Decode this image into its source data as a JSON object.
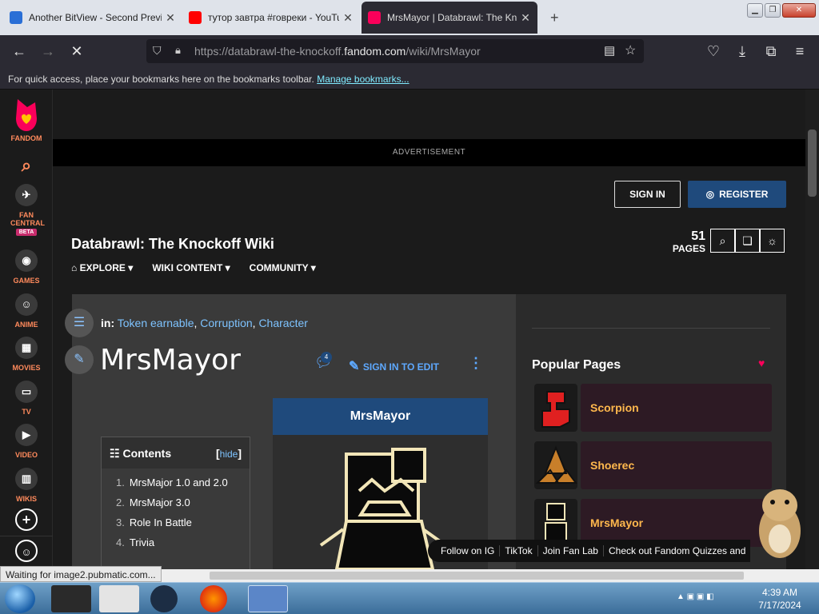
{
  "browser": {
    "tabs": [
      {
        "title": "Another BitView - Second Previ",
        "favicon_color": "#2a6fd6"
      },
      {
        "title": "тутор завтра #говреки - YouTu",
        "favicon_color": "#ff0000"
      },
      {
        "title": "MrsMayor | Databrawl: The Knoc",
        "favicon_color": "#fa005a"
      }
    ],
    "address": {
      "prefix": "https://databrawl-the-knockoff.",
      "domain": "fandom.com",
      "path": "/wiki/MrsMayor"
    },
    "bookmarks_message": "For quick access, place your bookmarks here on the bookmarks toolbar.",
    "bookmarks_link": "Manage bookmarks...",
    "status_text": "Waiting for image2.pubmatic.com..."
  },
  "fandom_sidebar": {
    "items": [
      {
        "label": "FANDOM"
      },
      {
        "label": "FAN CENTRAL",
        "badge": "BETA"
      },
      {
        "label": "GAMES"
      },
      {
        "label": "ANIME"
      },
      {
        "label": "MOVIES"
      },
      {
        "label": "TV"
      },
      {
        "label": "VIDEO"
      },
      {
        "label": "WIKIS"
      }
    ]
  },
  "ad": {
    "label": "ADVERTISEMENT"
  },
  "header": {
    "sign_in": "SIGN IN",
    "register": "REGISTER",
    "wiki_name": "Databrawl: The Knockoff Wiki",
    "pages_count": "51",
    "pages_label": "PAGES",
    "nav": [
      "EXPLORE",
      "WIKI CONTENT",
      "COMMUNITY"
    ]
  },
  "article": {
    "categories_prefix": "in:",
    "categories": [
      "Token earnable",
      "Corruption",
      "Character"
    ],
    "title": "MrsMayor",
    "comments_count": "4",
    "edit_label": "SIGN IN TO EDIT",
    "infobox_title": "MrsMayor",
    "toc": {
      "title": "Contents",
      "hide": "hide",
      "items": [
        {
          "num": "1.",
          "text": "MrsMajor 1.0 and 2.0"
        },
        {
          "num": "2.",
          "text": "MrsMajor 3.0"
        },
        {
          "num": "3.",
          "text": "Role In Battle"
        },
        {
          "num": "4.",
          "text": "Trivia"
        }
      ]
    }
  },
  "rail": {
    "popular_title": "Popular Pages",
    "pages": [
      "Scorpion",
      "Shoerec",
      "MrsMayor"
    ]
  },
  "fan_bar": [
    "Follow on IG",
    "TikTok",
    "Join Fan Lab",
    "Check out Fandom Quizzes and"
  ],
  "taskbar": {
    "time": "4:39 AM",
    "date": "7/17/2024"
  },
  "colors": {
    "fandom_accent": "#fa005a",
    "link_blue": "#7ec3ff",
    "register_blue": "#1f4a7c",
    "popular_label": "#ffb84d"
  }
}
